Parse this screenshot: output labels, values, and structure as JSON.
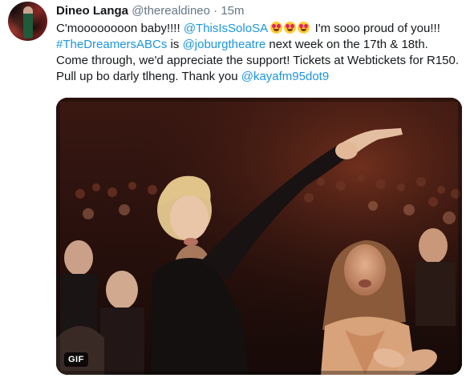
{
  "tweet": {
    "author_name": "Dineo Langa",
    "author_handle": "@therealdineo",
    "separator": "·",
    "timestamp": "15m",
    "text_1": "C'moooooooon baby!!!! ",
    "mention_solo": "@ThisIsSoloSA",
    "text_2": " I'm sooo proud of you!!! ",
    "hashtag": "#TheDreamersABCs",
    "text_3": " is ",
    "mention_theatre": "@joburgtheatre",
    "text_4": " next week on the 17th & 18th. Come through, we'd appreciate the support! Tickets at Webtickets for R150. Pull up bo darly tlheng. Thank you ",
    "mention_kaya": "@kayafm95dot9",
    "emoji_name": "smiling-face-with-heart-eyes",
    "emoji_count": 3,
    "media": {
      "type": "gif",
      "badge": "GIF"
    }
  },
  "colors": {
    "link": "#1b95e0",
    "text": "#14171a",
    "muted": "#657786",
    "background": "#ffffff"
  }
}
